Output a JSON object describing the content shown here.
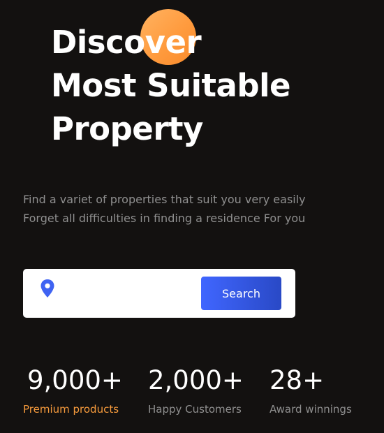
{
  "hero": {
    "headline_lines": [
      "Discover",
      "Most Suitable",
      "Property"
    ],
    "subtitle_lines": [
      "Find a variet of properties that suit you very easily",
      "Forget all difficulties in finding a residence For you"
    ]
  },
  "search": {
    "icon": "location-pin-icon",
    "placeholder": "",
    "value": "",
    "button_label": "Search"
  },
  "stats": [
    {
      "value": "9,000+",
      "label": "Premium products"
    },
    {
      "value": "2,000+",
      "label": "Happy Customers"
    },
    {
      "value": "28+",
      "label": "Award winnings"
    }
  ],
  "colors": {
    "background": "#131110",
    "accent_orange": "#ff9b3e",
    "accent_blue": "#3557e6",
    "text_primary": "#ffffff",
    "text_muted": "#8f8f8f"
  }
}
